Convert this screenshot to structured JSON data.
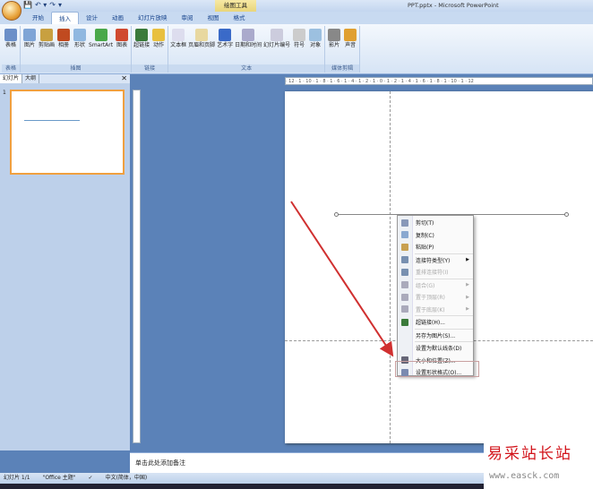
{
  "window": {
    "title": "PPT.pptx - Microsoft PowerPoint",
    "context_tool": "绘图工具"
  },
  "qat": [
    "💾",
    "↶ ▾",
    "↷",
    "▾"
  ],
  "tabs": [
    {
      "label": "开始"
    },
    {
      "label": "插入",
      "active": true
    },
    {
      "label": "设计"
    },
    {
      "label": "动画"
    },
    {
      "label": "幻灯片放映"
    },
    {
      "label": "审阅"
    },
    {
      "label": "视图"
    },
    {
      "label": "格式"
    }
  ],
  "ribbon": {
    "groups": [
      {
        "label": "表格",
        "buttons": [
          {
            "label": "表格",
            "icon": "table-icon",
            "color": "#6b8fc8"
          }
        ]
      },
      {
        "label": "插图",
        "buttons": [
          {
            "label": "图片",
            "icon": "picture-icon",
            "color": "#7fa5d6"
          },
          {
            "label": "剪贴画",
            "icon": "clipart-icon",
            "color": "#c8a040"
          },
          {
            "label": "相册",
            "icon": "album-icon",
            "color": "#c04a20"
          },
          {
            "label": "形状",
            "icon": "shapes-icon",
            "color": "#90b8e0"
          },
          {
            "label": "SmartArt",
            "icon": "smartart-icon",
            "color": "#4aa84a"
          },
          {
            "label": "图表",
            "icon": "chart-icon",
            "color": "#d04a30"
          }
        ]
      },
      {
        "label": "链接",
        "buttons": [
          {
            "label": "超链接",
            "icon": "hyperlink-icon",
            "color": "#3a7a3a"
          },
          {
            "label": "动作",
            "icon": "action-icon",
            "color": "#e8c040"
          }
        ]
      },
      {
        "label": "文本",
        "buttons": [
          {
            "label": "文本框",
            "icon": "textbox-icon",
            "color": "#dde"
          },
          {
            "label": "页眉和页脚",
            "icon": "header-footer-icon",
            "color": "#e8d8a0"
          },
          {
            "label": "艺术字",
            "icon": "wordart-icon",
            "color": "#3a6ac8"
          },
          {
            "label": "日期和时间",
            "icon": "date-time-icon",
            "color": "#aac"
          },
          {
            "label": "幻灯片编号",
            "icon": "slide-number-icon",
            "color": "#ccd"
          },
          {
            "label": "符号",
            "icon": "symbol-icon",
            "color": "#ccc"
          },
          {
            "label": "对象",
            "icon": "object-icon",
            "color": "#9cc0e0"
          }
        ]
      },
      {
        "label": "媒体剪辑",
        "buttons": [
          {
            "label": "影片",
            "icon": "movie-icon",
            "color": "#888"
          },
          {
            "label": "声音",
            "icon": "sound-icon",
            "color": "#e0a030"
          }
        ]
      }
    ]
  },
  "left_panel": {
    "tabs": [
      "幻灯片",
      "大纲"
    ],
    "close": "✕",
    "slide_number": "1"
  },
  "ruler_text": "· 12 · 1 · 10 · 1 · 8 · 1 · 6 · 1 · 4 · 1 · 2 · 1 · 0 · 1 · 2 · 1 · 4 · 1 · 6 · 1 · 8 · 1 · 10 · 1 · 12",
  "context_menu": {
    "items": [
      {
        "label": "剪切(T)",
        "icon": "cut-icon",
        "color": "#8898b8"
      },
      {
        "label": "复制(C)",
        "icon": "copy-icon",
        "color": "#8aa8d0"
      },
      {
        "label": "粘贴(P)",
        "icon": "paste-icon",
        "color": "#c8a050",
        "sep_after": true
      },
      {
        "label": "连接符类型(Y)",
        "icon": "connector-type-icon",
        "color": "#7890b0",
        "submenu": true
      },
      {
        "label": "重排连接符(I)",
        "icon": "reroute-icon",
        "color": "#7890b0",
        "disabled": true,
        "sep_after": true
      },
      {
        "label": "组合(G)",
        "icon": "group-icon",
        "color": "#aab",
        "disabled": true,
        "submenu": true
      },
      {
        "label": "置于顶层(R)",
        "icon": "bring-front-icon",
        "color": "#aab",
        "disabled": true,
        "submenu": true
      },
      {
        "label": "置于底层(K)",
        "icon": "send-back-icon",
        "color": "#aab",
        "disabled": true,
        "submenu": true,
        "sep_after": true
      },
      {
        "label": "超链接(H)...",
        "icon": "hyperlink-icon",
        "color": "#3a7a3a",
        "sep_after": true
      },
      {
        "label": "另存为图片(S)...",
        "icon": "",
        "color": "",
        "sep_after": true
      },
      {
        "label": "设置为默认线条(D)",
        "icon": "",
        "color": ""
      },
      {
        "label": "大小和位置(Z)...",
        "icon": "size-position-icon",
        "color": "#667"
      },
      {
        "label": "设置形状格式(O)...",
        "icon": "format-shape-icon",
        "color": "#7a8ab0"
      }
    ],
    "submenu_arrow": "▶"
  },
  "notes": {
    "placeholder": "单击此处添加备注"
  },
  "status": {
    "slide": "幻灯片 1/1",
    "theme": "\"Office 主题\"",
    "check_icon": "✓",
    "language": "中文(简体，中国)"
  },
  "watermark": {
    "cn": "易采站长站",
    "url": "www.easck.com"
  },
  "colors": {
    "arrow": "#d03030",
    "ribbon_bg": "#d6e4f5",
    "workspace": "#5b82b8"
  }
}
